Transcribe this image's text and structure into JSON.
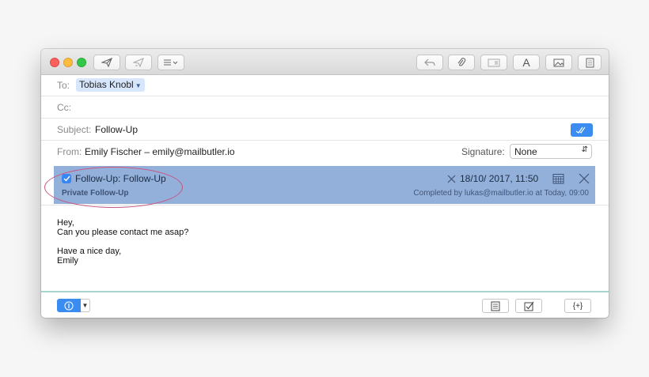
{
  "header": {
    "to_label": "To:",
    "to_recipient": "Tobias Knobl",
    "cc_label": "Cc:",
    "subject_label": "Subject:",
    "subject_value": "Follow-Up",
    "from_label": "From:",
    "from_value": "Emily Fischer – emily@mailbutler.io",
    "signature_label": "Signature:",
    "signature_value": "None"
  },
  "toolbar": {
    "font_button_label": "A"
  },
  "followup": {
    "title": "Follow-Up: Follow-Up",
    "subtitle": "Private Follow-Up",
    "datetime": "18/10/ 2017,  11:50",
    "completed": "Completed by lukas@mailbutler.io at Today, 09:00",
    "checked": true
  },
  "message": {
    "line1": "Hey,",
    "line2": "Can you please contact me asap?",
    "line3": "Have a nice day,",
    "line4": "Emily"
  },
  "bottombar": {
    "snippet_label": "{+}"
  },
  "colors": {
    "accent": "#3b8cf0",
    "followup_bg": "#93b0da",
    "annotation": "#c8557e"
  }
}
